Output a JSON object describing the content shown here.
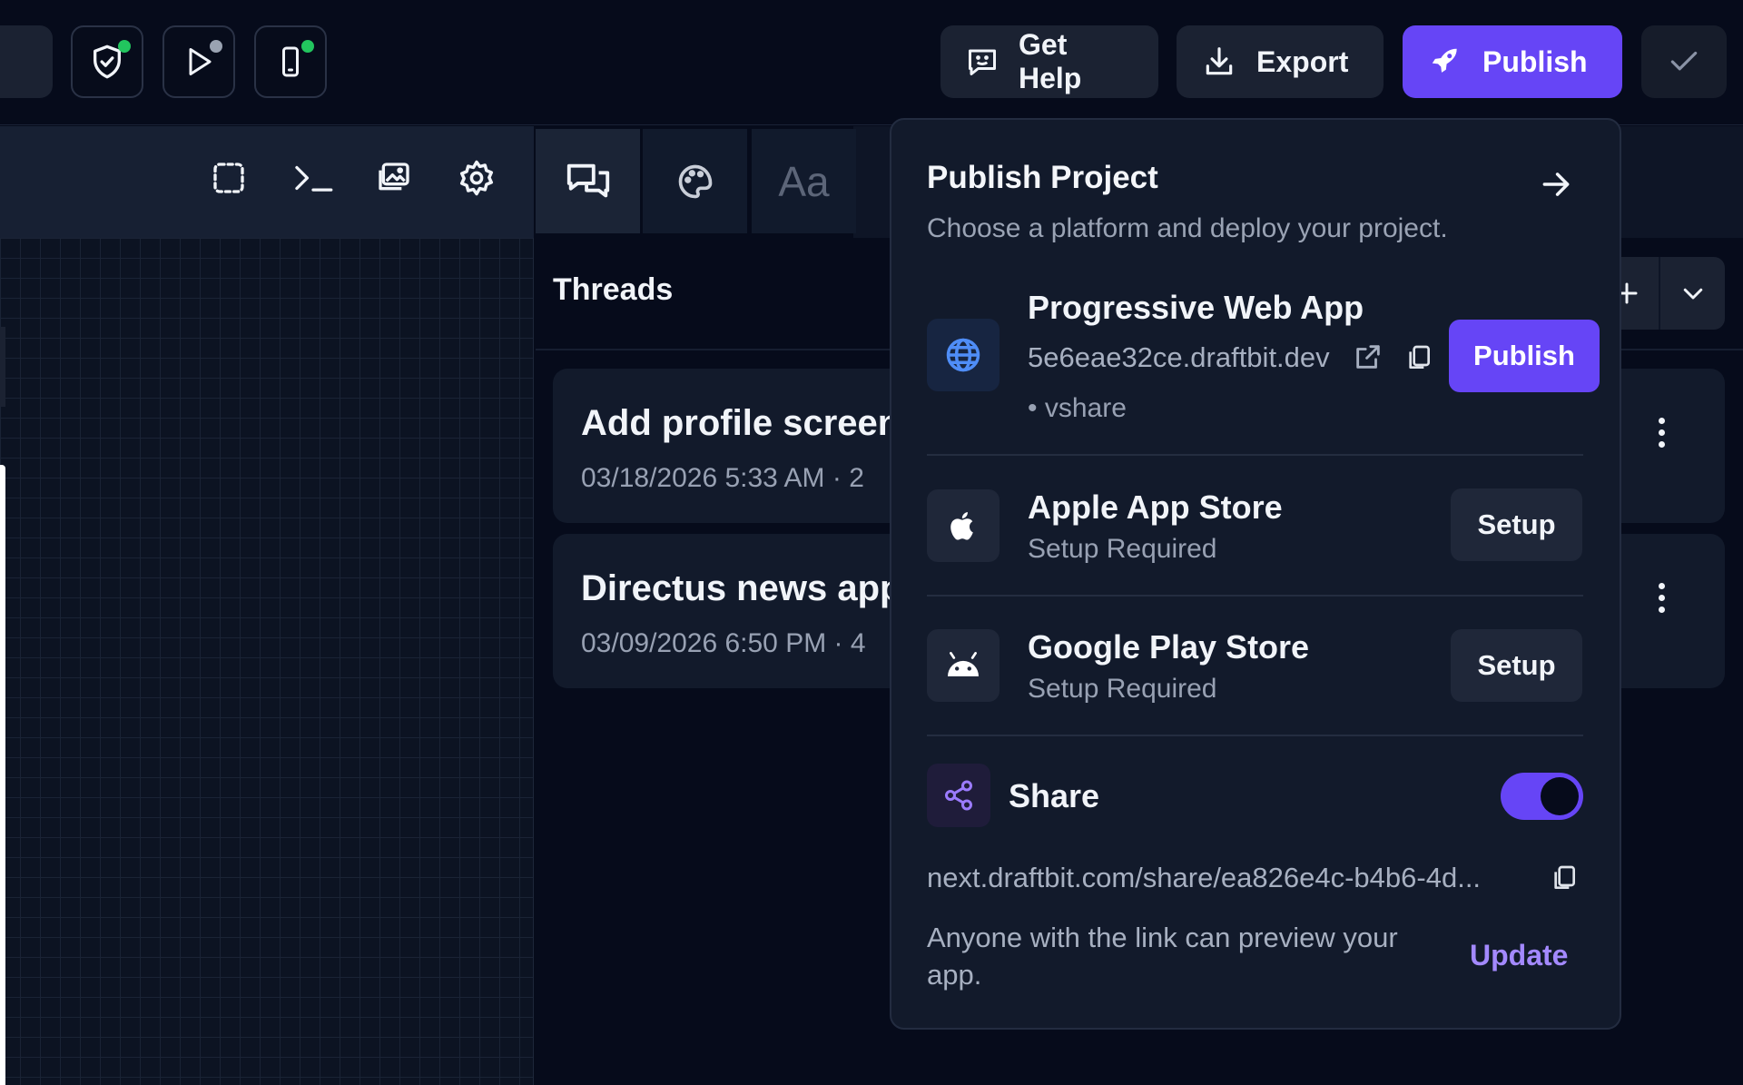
{
  "topbar": {
    "get_help_label": "Get Help",
    "export_label": "Export",
    "publish_label": "Publish"
  },
  "threads": {
    "title": "Threads",
    "items": [
      {
        "title": "Add profile screen",
        "meta": "03/18/2026 5:33 AM · 2"
      },
      {
        "title": "Directus news app",
        "meta": "03/09/2026 6:50 PM · 4"
      }
    ]
  },
  "sidebar_tabs": {
    "typography_label": "Aa"
  },
  "publish_popover": {
    "title": "Publish Project",
    "subtitle": "Choose a platform and deploy your project.",
    "pwa": {
      "name": "Progressive Web App",
      "url": "5e6eae32ce.draftbit.dev",
      "tag": "• vshare",
      "publish_label": "Publish"
    },
    "apple": {
      "name": "Apple App Store",
      "status": "Setup Required",
      "setup_label": "Setup"
    },
    "google": {
      "name": "Google Play Store",
      "status": "Setup Required",
      "setup_label": "Setup"
    },
    "share": {
      "label": "Share",
      "enabled": true,
      "url": "next.draftbit.com/share/ea826e4c-b4b6-4d...",
      "note": "Anyone with the link can preview your app.",
      "update_label": "Update"
    }
  },
  "colors": {
    "accent": "#6645f6",
    "background": "#060b1b",
    "panel": "#121a2b",
    "link": "#a389ff",
    "status_green": "#22c55e"
  }
}
